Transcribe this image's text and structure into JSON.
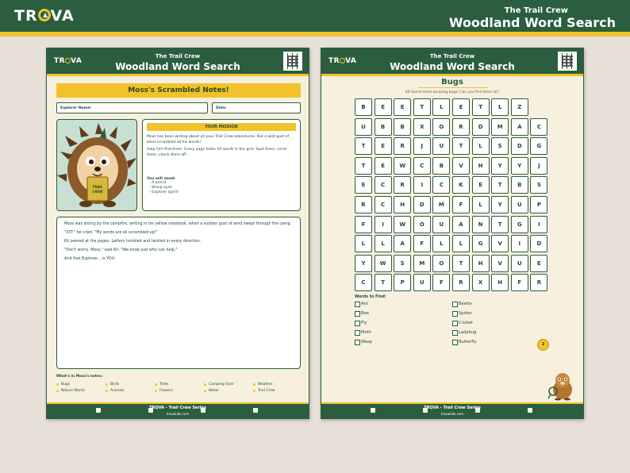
{
  "banner": {
    "logo": "TRQVA",
    "subtitle": "The Trail Crew",
    "title": "Woodland Word Search"
  },
  "page_left": {
    "logo": "TRQVA",
    "subtitle": "The Trail Crew",
    "title": "Woodland Word Search",
    "notes_title": "Moss's Scrambled Notes!",
    "explorer_label": "Explorer Name:",
    "date_label": "Date:",
    "mission_heading": "YOUR MISSION",
    "mission_p1": "Moss has been writing about all your Trail Crew adventures. But a wild gust of wind scrambled all his words!",
    "mission_p2": "Help him find them. Every page hides 10 words in the grid. Spot them, circle them, check them off.",
    "need_label": "You will need:",
    "need_items": [
      "- A pencil",
      "- Sharp eyes",
      "- Explorer spirit!"
    ],
    "story": [
      "Moss was sitting by the campfire, writing in his yellow notebook, when a sudden gust of wind swept through the camp.",
      "\"XIT!\" he cried. \"My words are all scrambled up!\"",
      "Kit peered at the pages. Letters tumbled and twisted in every direction.",
      "\"Don't worry, Moss,\" said Kit. \"We know just who can help.\"",
      "And that Explorer... is YOU."
    ],
    "categories_label": "What's in Moss's notes:",
    "categories": [
      "Bugs",
      "Birds",
      "Trees",
      "Camping Gear",
      "Weather",
      "Nature Words",
      "Animals",
      "Flowers",
      "Water",
      "Trail Crew"
    ],
    "footer_series": "TRQVA - Trail Crew Series",
    "footer_url": "trovakids.com"
  },
  "page_right": {
    "logo": "TRQVA",
    "subtitle": "The Trail Crew",
    "title": "Woodland Word Search",
    "theme": "Bugs",
    "theme_sub": "Kit found some amazing bugs! Can you find them all?",
    "grid": [
      [
        "B",
        "E",
        "E",
        "T",
        "L",
        "E",
        "T",
        "L",
        "Z"
      ],
      [
        "U",
        "B",
        "B",
        "X",
        "O",
        "R",
        "D",
        "M",
        "A",
        "C"
      ],
      [
        "T",
        "E",
        "R",
        "J",
        "U",
        "T",
        "L",
        "S",
        "D",
        "G"
      ],
      [
        "T",
        "E",
        "W",
        "C",
        "B",
        "V",
        "H",
        "Y",
        "Y",
        "J"
      ],
      [
        "E",
        "C",
        "R",
        "I",
        "C",
        "K",
        "E",
        "T",
        "B",
        "S"
      ],
      [
        "R",
        "C",
        "H",
        "D",
        "M",
        "F",
        "L",
        "Y",
        "U",
        "P"
      ],
      [
        "F",
        "I",
        "W",
        "O",
        "U",
        "A",
        "N",
        "T",
        "G",
        "I"
      ],
      [
        "L",
        "L",
        "A",
        "F",
        "L",
        "L",
        "G",
        "V",
        "I",
        "D"
      ],
      [
        "Y",
        "W",
        "S",
        "M",
        "O",
        "T",
        "H",
        "V",
        "U",
        "E"
      ],
      [
        "C",
        "T",
        "P",
        "U",
        "F",
        "R",
        "X",
        "H",
        "F",
        "R"
      ]
    ],
    "words_label": "Words to Find:",
    "words": [
      "Ant",
      "Beetle",
      "Bee",
      "Spider",
      "Fly",
      "Cricket",
      "Moth",
      "Ladybug",
      "Wasp",
      "Butterfly"
    ],
    "page_number": "2",
    "footer_series": "TRQVA - Trail Crew Series",
    "footer_url": "trovakids.com"
  },
  "colors": {
    "forest_green": "#2a5e3f",
    "sunflower_yellow": "#f2c22a",
    "paper": "#f7f0df",
    "mint": "#c7e0d3"
  }
}
